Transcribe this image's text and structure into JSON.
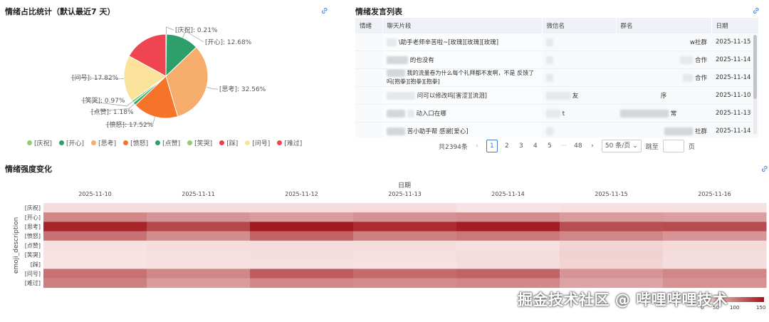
{
  "emotion_share": {
    "title": "情绪占比统计（默认最近7 天）",
    "link_icon": "link-icon",
    "slices": [
      {
        "name": "[庆祝]",
        "percent": 0.21,
        "label": "[庆祝]: 0.21%",
        "color": "#91cc75"
      },
      {
        "name": "[开心]",
        "percent": 12.68,
        "label": "[开心]: 12.68%",
        "color": "#2e9e6a"
      },
      {
        "name": "[思考]",
        "percent": 32.56,
        "label": "[思考]: 32.56%",
        "color": "#f6ad6b"
      },
      {
        "name": "[愤怒]",
        "percent": 17.52,
        "label": "[愤怒]: 17.52%",
        "color": "#f5742a"
      },
      {
        "name": "[点赞]",
        "percent": 1.18,
        "label": "[点赞]: 1.18%",
        "color": "#3aa86b"
      },
      {
        "name": "[笑哭]",
        "percent": 0.97,
        "label": "[笑哭]: 0.97%",
        "color": "#91cc75"
      },
      {
        "name": "[踩]",
        "percent": 0.03,
        "label": "",
        "color": "#ee3c4b"
      },
      {
        "name": "[问号]",
        "percent": 17.82,
        "label": "[问号]: 17.82%",
        "color": "#fbe29a"
      },
      {
        "name": "[难过]",
        "percent": 17.03,
        "label": "",
        "color": "#ee4550"
      }
    ],
    "legend": [
      {
        "name": "[庆祝]",
        "color": "#91cc75"
      },
      {
        "name": "[开心]",
        "color": "#2e9e6a"
      },
      {
        "name": "[思考]",
        "color": "#f6ad6b"
      },
      {
        "name": "[愤怒]",
        "color": "#f5742a"
      },
      {
        "name": "[点赞]",
        "color": "#2e9e6a"
      },
      {
        "name": "[笑哭]",
        "color": "#91cc75"
      },
      {
        "name": "[踩]",
        "color": "#ee3c4b"
      },
      {
        "name": "[问号]",
        "color": "#fbe29a"
      },
      {
        "name": "[难过]",
        "color": "#ee4550"
      }
    ]
  },
  "speech_list": {
    "title": "情绪发言列表",
    "columns": [
      "情绪",
      "聊天片段",
      "微信名",
      "群名",
      "日期"
    ],
    "rows": [
      {
        "snippet": "\\助手老师辛苦啦~[玫瑰][玫瑰][玫瑰]",
        "group_suffix": "w社群",
        "date": "2025-11-15"
      },
      {
        "snippet": "的也没有",
        "group_suffix": "合作",
        "date": "2025-11-14"
      },
      {
        "snippet": "我的流量卷为什么每个礼拜都不发啊，不是 反馈了吗[抱拳][抱拳][抱拳]",
        "group_suffix": "合作",
        "date": "2025-11-14"
      },
      {
        "snippet": "问可以修改吗[害涩][流泪]",
        "wechat_suffix": "友",
        "group_suffix": "序",
        "date": "2025-11-10"
      },
      {
        "snippet": "动入口在哪",
        "wechat_suffix": "t",
        "group_suffix": "常",
        "date": "2025-11-13"
      },
      {
        "snippet": "苦小助手帮 感谢[爱心]",
        "group_suffix": "社群",
        "date": "2025-11-14"
      }
    ],
    "pagination": {
      "total": "共2394条",
      "pages": [
        "1",
        "2",
        "3",
        "4",
        "5",
        "···",
        "48"
      ],
      "page_size": "50 条/页",
      "jump_label": "跳至",
      "page_unit": "页"
    }
  },
  "intensity": {
    "title": "情绪强度变化",
    "chart_data": {
      "type": "heatmap",
      "xlabel": "日期",
      "ylabel": "emoji_description",
      "x": [
        "2025-11-10",
        "2025-11-11",
        "2025-11-12",
        "2025-11-13",
        "2025-11-14",
        "2025-11-15",
        "2025-11-16"
      ],
      "y": [
        "[庆祝]",
        "[开心]",
        "[思考]",
        "[愤怒]",
        "[点赞]",
        "[笑哭]",
        "[踩]",
        "[问号]",
        "[难过]"
      ],
      "values": [
        [
          8,
          8,
          8,
          8,
          4,
          6,
          6
        ],
        [
          70,
          60,
          55,
          62,
          66,
          55,
          52
        ],
        [
          140,
          115,
          148,
          135,
          145,
          110,
          112
        ],
        [
          85,
          65,
          95,
          75,
          80,
          70,
          60
        ],
        [
          6,
          8,
          8,
          8,
          6,
          14,
          10
        ],
        [
          4,
          6,
          8,
          6,
          8,
          16,
          8
        ],
        [
          4,
          6,
          6,
          5,
          8,
          14,
          8
        ],
        [
          85,
          70,
          100,
          90,
          95,
          60,
          70
        ],
        [
          75,
          55,
          70,
          65,
          70,
          50,
          62
        ]
      ],
      "colorscale": {
        "min": 0,
        "max": 150,
        "low_color": "#fbe8e8",
        "high_color": "#a1161b",
        "ticks": [
          "0",
          "50",
          "100",
          "150"
        ]
      }
    }
  },
  "watermark": "掘金技术社区 @ 哔哩哔哩技术"
}
